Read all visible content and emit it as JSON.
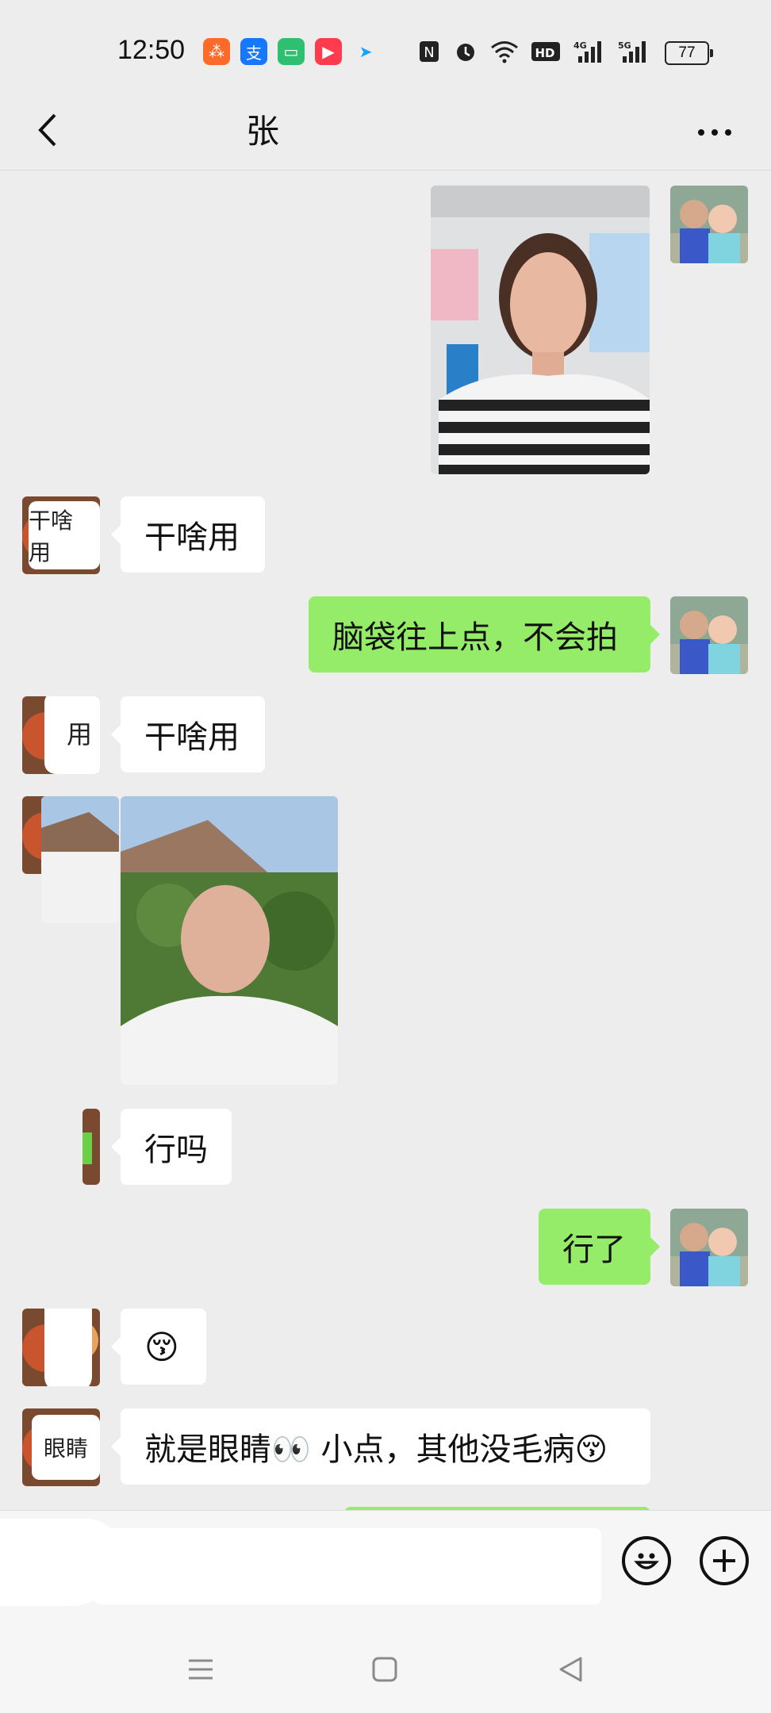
{
  "status_bar": {
    "time": "12:50",
    "battery": "77",
    "icons": [
      "app-icon-orange",
      "alipay-icon",
      "message-icon",
      "video-icon",
      "maps-icon",
      "nfc-icon",
      "alarm-icon",
      "wifi-icon",
      "hd-icon",
      "signal-4g-icon",
      "signal-5g-icon",
      "battery-icon"
    ]
  },
  "header": {
    "title": "张",
    "back_icon": "chevron-left-icon",
    "more_icon": "more-dots-icon"
  },
  "messages": [
    {
      "side": "right",
      "type": "image",
      "desc_icon": "photo-woman"
    },
    {
      "side": "left",
      "type": "text",
      "text": "干啥用",
      "avatar_overlay": "干啥 用"
    },
    {
      "side": "right",
      "type": "text",
      "text": "脑袋往上点，不会拍"
    },
    {
      "side": "left",
      "type": "text",
      "text": "干啥用",
      "avatar_overlay": "用"
    },
    {
      "side": "left",
      "type": "image",
      "desc_icon": "photo-man"
    },
    {
      "side": "left",
      "type": "text",
      "text": "行吗"
    },
    {
      "side": "right",
      "type": "text",
      "text": "行了"
    },
    {
      "side": "left",
      "type": "text",
      "text": "😚"
    },
    {
      "side": "left",
      "type": "text",
      "text": "就是眼睛👀 小点，其他没毛病😚",
      "avatar_overlay": "眼睛"
    }
  ],
  "input_bar": {
    "emoji_icon": "smiley-icon",
    "plus_icon": "plus-icon"
  },
  "nav_bar": {
    "menu_icon": "menu-icon",
    "home_icon": "home-icon",
    "back_icon": "back-triangle-icon"
  },
  "colors": {
    "bubble_green": "#95ec69",
    "bubble_white": "#ffffff",
    "background": "#ededed"
  }
}
